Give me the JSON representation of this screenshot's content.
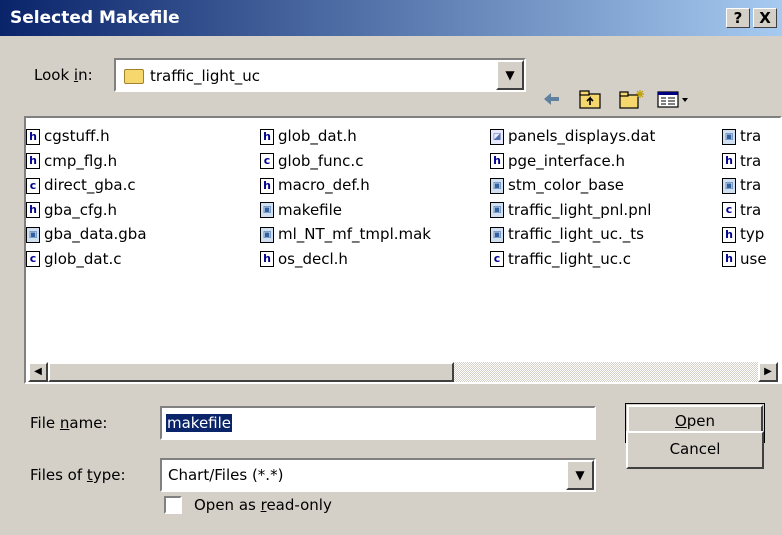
{
  "window": {
    "title": "Selected Makefile",
    "help_label": "?",
    "close_label": "X"
  },
  "lookin": {
    "label_pre": "Look ",
    "label_key": "i",
    "label_post": "n:",
    "value": "traffic_light_uc"
  },
  "toolbar": {
    "back_icon": "back-arrow-icon",
    "up_icon": "up-folder-icon",
    "new_icon": "new-folder-icon",
    "view_icon": "view-menu-icon"
  },
  "files": [
    {
      "name": "cgstuff.h",
      "type": "h"
    },
    {
      "name": "cmp_flg.h",
      "type": "h"
    },
    {
      "name": "direct_gba.c",
      "type": "c"
    },
    {
      "name": "gba_cfg.h",
      "type": "h"
    },
    {
      "name": "gba_data.gba",
      "type": "img"
    },
    {
      "name": "glob_dat.c",
      "type": "c"
    },
    {
      "name": "glob_dat.h",
      "type": "h"
    },
    {
      "name": "glob_func.c",
      "type": "c"
    },
    {
      "name": "macro_def.h",
      "type": "h"
    },
    {
      "name": "makefile",
      "type": "img"
    },
    {
      "name": "ml_NT_mf_tmpl.mak",
      "type": "img"
    },
    {
      "name": "os_decl.h",
      "type": "h"
    },
    {
      "name": "panels_displays.dat",
      "type": "dat"
    },
    {
      "name": "pge_interface.h",
      "type": "h"
    },
    {
      "name": "stm_color_base",
      "type": "img"
    },
    {
      "name": "traffic_light_pnl.pnl",
      "type": "img"
    },
    {
      "name": "traffic_light_uc._ts",
      "type": "img"
    },
    {
      "name": "traffic_light_uc.c",
      "type": "c"
    },
    {
      "name": "tra",
      "type": "img"
    },
    {
      "name": "tra",
      "type": "h"
    },
    {
      "name": "tra",
      "type": "img"
    },
    {
      "name": "tra",
      "type": "c"
    },
    {
      "name": "typ",
      "type": "h"
    },
    {
      "name": "use",
      "type": "h"
    }
  ],
  "filename": {
    "label_pre": "File ",
    "label_key": "n",
    "label_post": "ame:",
    "value": "makefile"
  },
  "filetype": {
    "label_pre": "Files of ",
    "label_key": "t",
    "label_post": "ype:",
    "value": "Chart/Files (*.*)"
  },
  "readonly": {
    "label_pre": "Open as ",
    "label_key": "r",
    "label_post": "ead-only"
  },
  "buttons": {
    "open_key": "O",
    "open_rest": "pen",
    "cancel": "Cancel"
  }
}
